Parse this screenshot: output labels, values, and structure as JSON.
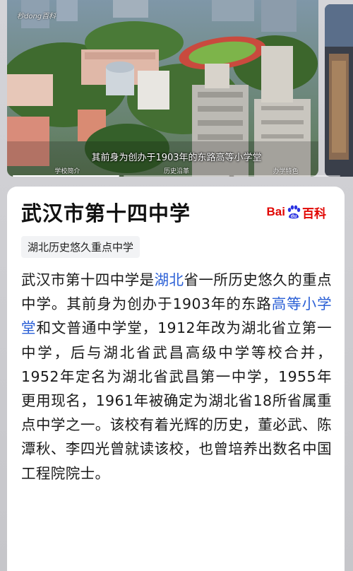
{
  "carousel": {
    "caption": "其前身为创办于1903年的东路高等小学堂",
    "watermark": "秒dong百科",
    "tabs": [
      "学校简介",
      "历史沿革",
      "办学特色"
    ]
  },
  "card": {
    "title": "武汉市第十四中学",
    "logo": {
      "bai": "Bai",
      "du": "du",
      "baike": "百科"
    },
    "tag": "湖北历史悠久重点中学",
    "description": {
      "p1": "武汉市第十四中学是",
      "link1": "湖北",
      "p2": "省一所历史悠久的重点中学。其前身为创办于1903年的东路",
      "link2": "高等小学堂",
      "p3": "和文普通中学堂，1912年改为湖北省立第一中学，后与湖北省武昌高级中学等校合并，1952年定名为湖北省武昌第一中学，1955年更用现名，1961年被确定为湖北省18所省属重点中学之一。该校有着光辉的历史，董必武、陈潭秋、李四光曾就读该校，也曾培养出数名中国工程院院士。"
    }
  },
  "colors": {
    "link": "#2a5fd6",
    "baidu_red": "#e10602",
    "baidu_blue": "#2932e1",
    "tag_bg": "#f2f3f5"
  }
}
